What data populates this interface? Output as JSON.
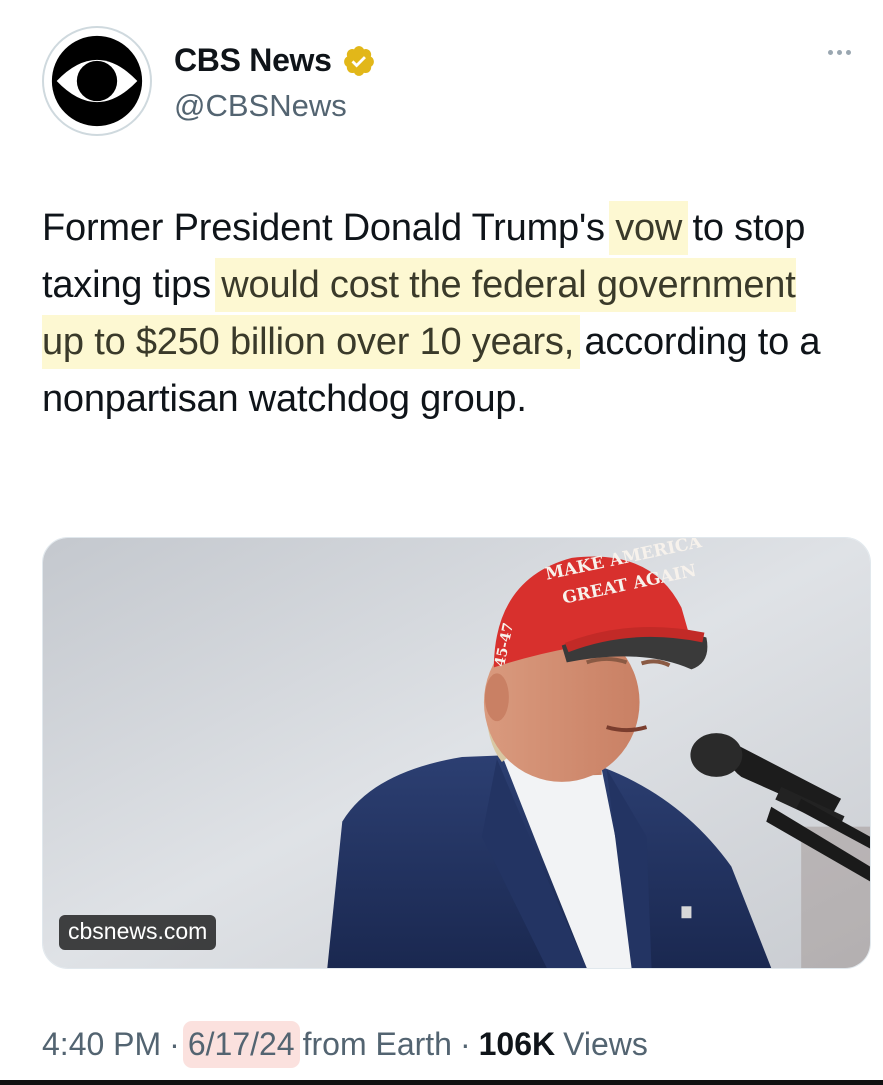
{
  "account": {
    "display_name": "CBS News",
    "handle": "@CBSNews",
    "verified": true,
    "verified_color": "#e2b719",
    "avatar_icon": "cbs-eye-logo"
  },
  "menu": {
    "icon": "more-horizontal-icon"
  },
  "tweet": {
    "text_parts": {
      "p1": "Former President Donald Trump's ",
      "p2": "vow",
      "p3": " to stop taxing tips ",
      "p4": "would cost the federal government up to $250 billion over 10 years,",
      "p5": " according to a nonpartisan watchdog group."
    },
    "highlight_color": "#fdf8d2"
  },
  "media": {
    "domain_label": "cbsnews.com",
    "hat_text_line1": "MAKE AMERICA",
    "hat_text_line2": "GREAT AGAIN",
    "hat_side_text": "45-47"
  },
  "meta": {
    "time": "4:40 PM",
    "separator": "·",
    "date": "6/17/24",
    "source": "from Earth",
    "views_count": "106K",
    "views_label": "Views",
    "date_highlight_color": "#fbe1de"
  }
}
